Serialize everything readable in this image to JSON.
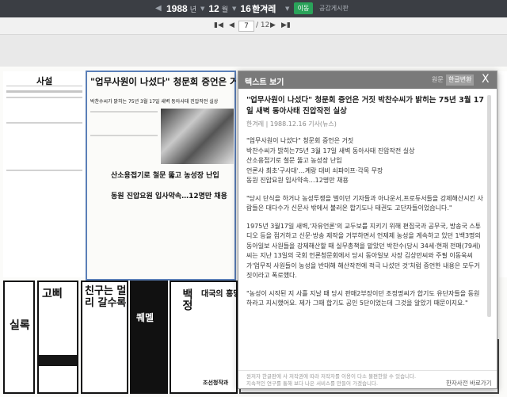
{
  "topbar": {
    "year": "1988",
    "month": "12",
    "day": "16",
    "year_unit": "년",
    "month_unit": "월",
    "day_unit": "일",
    "newspaper": "한겨레",
    "move_label": "이동",
    "board_label": "공감게시판",
    "prev_icon": "chevron-left-icon",
    "dropdown_icon": "chevron-down-icon",
    "accent_color": "#2aa35a"
  },
  "pager": {
    "current_page": "7",
    "total_pages": "/ 12",
    "first_icon": "first-page-icon",
    "prev_icon": "prev-page-icon",
    "next_icon": "next-page-icon",
    "last_icon": "last-page-icon"
  },
  "newspaper": {
    "editorial_title": "사설",
    "main_headline": "\"업무사원이 나섰다\" 청문회 증언은 거짓",
    "sub_headline": "박찬수씨가 밝히는 75년 3월 17일 새벽 동아사태 진압작전 실상",
    "headline_2": "산소용접기로 철문 뚫고 농성장 난입",
    "headline_3": "동원 진압요원 입사약속…12명만 채용",
    "ad_1": "고삐",
    "ad_2": "친구는 멀리 갈수록",
    "ad_3": "퀘멜",
    "ad_4": "대국의 흥망",
    "ad_5": "실록",
    "ad_6": "백정",
    "ad_7": "조선청작과"
  },
  "textview": {
    "title": "텍스트 보기",
    "original_label": "원문",
    "hangul_convert_label": "한글변환",
    "close_label": "X",
    "article_title": "\"업무사원이 나섰다\" 청문회 증언은 거짓 박찬수씨가 밝히는 75년 3월 17일 새벽 동아사태 진압작전 실상",
    "article_meta": "한겨레 | 1988.12.16 기사(뉴스)",
    "paragraphs": [
      "\"업무사원이 나섰다\" 청문회 증언은 거짓\n박찬수씨가 밝히는75년 3월 17일 새벽 동아사태 진압작전 실상\n산소용접기로 철문 뚫고 농성장 난입\n언론사 최초'구사대'…계랑 대비 쇠파이프·각목 무장\n동원 진압요원 입사약속…12명만 채용",
      "\"당시 단식을 하거나 농성투쟁을 벌이던 기자들과 아나운서,프로듀서들을 강제해산시킨 사람들은 대다수가 신문사 밖에서 불러온 합기도나 태권도 고단자들이었습니다.\"",
      "1975년 3월17일 새벽,'자유언론'의 교두보를 지키기 위해 편집국과 공무국, 방송국 스튜디오 등을 점거하고 신문·방송 제작을 거부하면서 언제제 농성을 계속하고 있던 1백3명의 동아일보 사원들을 강제해산할 때 실무총책을 맡았던 박찬수(당시 34세·현재 전매(79세)씨는 지난 13일의 국회 언론청문회에서 당시 동아일보 사장 김상만씨와 주필 이동욱씨가'업무직 사원들이 농성을 반대해 해산작전에 적극 나섰던 것'처럼 증언한 내용은 모두거짓이라고 폭로했다.",
      "\"농성이 시작된 지 사흘 지날 때 당시 판매2부장이던 조정명씨가 합기도 유단자들을 동원하라고 지시했어요. 제가 그때 합기도 공인 5단이었는데 그것을 알았기 때문이지요.\""
    ],
    "notice": "원저자 한글판에 사 저작권에 따라 저작자를 이용이 다소 불편한할 수 있습니다. 지속적인 연구를 통해 보다 나은 서비스를 만들어 가겠습니다.",
    "hanja_label": "한자사전 바로가기"
  }
}
